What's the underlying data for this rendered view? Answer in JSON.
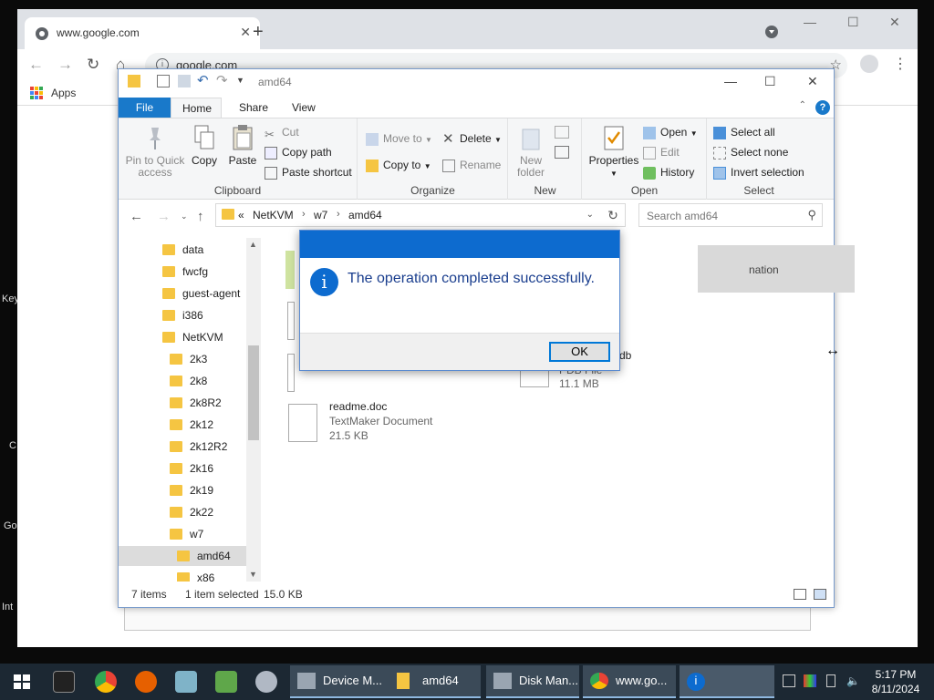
{
  "desktop": {
    "side_labels": [
      "Key",
      "C",
      "Go",
      "Int"
    ]
  },
  "chrome": {
    "tab_title": "www.google.com",
    "tab_close": "✕",
    "new_tab": "+",
    "win_min": "—",
    "win_max": "☐",
    "win_close": "✕",
    "url": "google.com",
    "bookmarks": {
      "apps_label": "Apps"
    }
  },
  "explorer": {
    "title": "amd64",
    "tabs": {
      "file": "File",
      "home": "Home",
      "share": "Share",
      "view": "View"
    },
    "ribbon": {
      "clipboard": {
        "label": "Clipboard",
        "pin": "Pin to Quick access",
        "copy": "Copy",
        "paste": "Paste",
        "cut": "Cut",
        "copy_path": "Copy path",
        "paste_shortcut": "Paste shortcut"
      },
      "organize": {
        "label": "Organize",
        "move_to": "Move to",
        "copy_to": "Copy to",
        "delete": "Delete",
        "rename": "Rename"
      },
      "new": {
        "label": "New",
        "new_folder": "New folder"
      },
      "open": {
        "label": "Open",
        "properties": "Properties",
        "open": "Open",
        "edit": "Edit",
        "history": "History"
      },
      "select": {
        "label": "Select",
        "select_all": "Select all",
        "select_none": "Select none",
        "invert": "Invert selection"
      }
    },
    "address": {
      "prefix": "«",
      "crumbs": [
        "NetKVM",
        "w7",
        "amd64"
      ],
      "search_placeholder": "Search amd64"
    },
    "tree": [
      {
        "label": "data"
      },
      {
        "label": "fwcfg"
      },
      {
        "label": "guest-agent"
      },
      {
        "label": "i386"
      },
      {
        "label": "NetKVM"
      },
      {
        "label": "2k3"
      },
      {
        "label": "2k8"
      },
      {
        "label": "2k8R2"
      },
      {
        "label": "2k12"
      },
      {
        "label": "2k12R2"
      },
      {
        "label": "2k16"
      },
      {
        "label": "2k19"
      },
      {
        "label": "2k22"
      },
      {
        "label": "w7"
      },
      {
        "label": "amd64"
      },
      {
        "label": "x86"
      }
    ],
    "files": {
      "selected_partial": "nation",
      "pdb_partial_name": "db",
      "pdb_type": "PDB File",
      "pdb_size": "11.1 MB",
      "readme_name": "readme.doc",
      "readme_type": "TextMaker Document",
      "readme_size": "21.5 KB"
    },
    "status": {
      "items": "7 items",
      "selected": "1 item selected",
      "size": "15.0 KB"
    }
  },
  "dialog": {
    "message": "The operation completed successfully.",
    "ok": "OK"
  },
  "taskbar": {
    "apps": [
      {
        "label": "Device M..."
      },
      {
        "label": "amd64"
      },
      {
        "label": "Disk Man..."
      },
      {
        "label": "www.go..."
      }
    ],
    "clock_time": "5:17 PM",
    "clock_date": "8/11/2024"
  }
}
